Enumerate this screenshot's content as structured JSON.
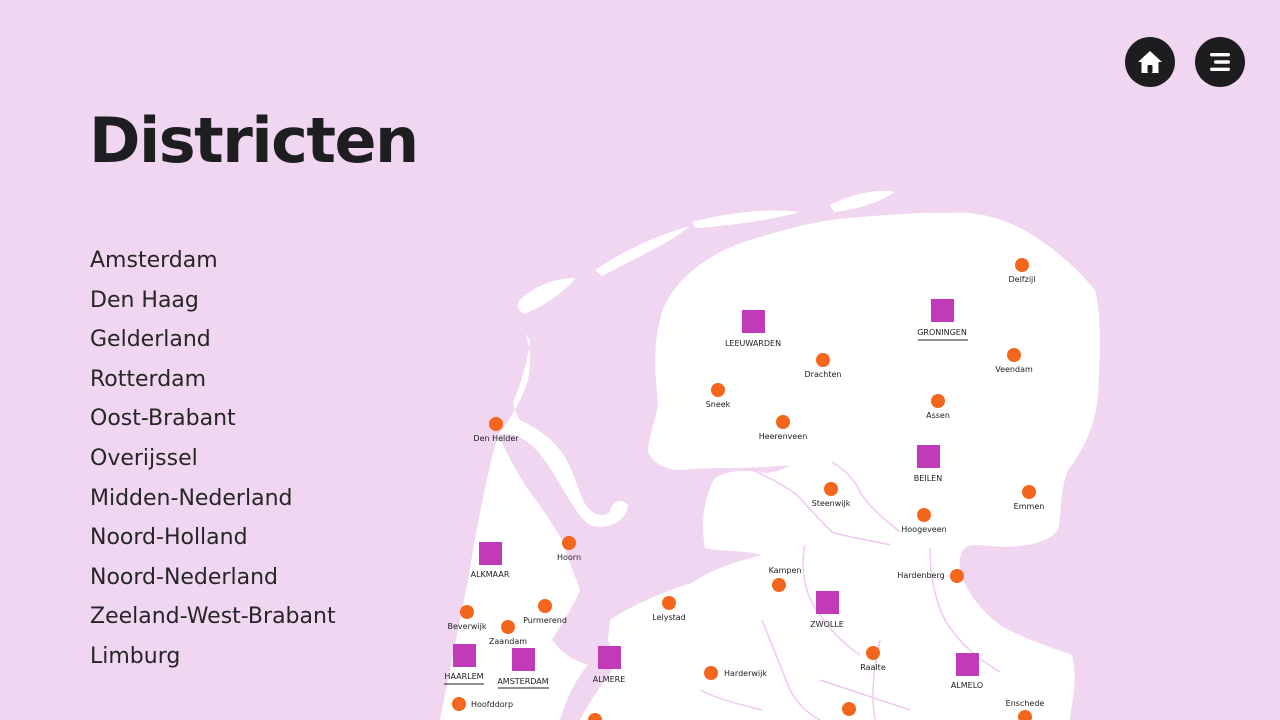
{
  "page_title": "Districten",
  "nav": {
    "home_icon": "home-icon",
    "menu_icon": "hamburger-menu-icon"
  },
  "districts": [
    "Amsterdam",
    "Den Haag",
    "Gelderland",
    "Rotterdam",
    "Oost-Brabant",
    "Overijssel",
    "Midden-Nederland",
    "Noord-Holland",
    "Noord-Nederland",
    "Zeeland-West-Brabant",
    "Limburg"
  ],
  "colors": {
    "background": "#f0d6f1",
    "land": "#ffffff",
    "district_office": "#c13ab8",
    "location": "#f4661b",
    "text": "#1e1e20"
  },
  "map": {
    "district_offices": [
      "LEEUWARDEN",
      "GRONINGEN",
      "BEILEN",
      "ALKMAAR",
      "ZWOLLE",
      "HAARLEM",
      "AMSTERDAM",
      "ALMERE",
      "ALMELO"
    ],
    "underlined_offices": [
      "GRONINGEN",
      "HAARLEM",
      "AMSTERDAM"
    ],
    "locations": [
      "Delfzijl",
      "Veendam",
      "Drachten",
      "Sneek",
      "Assen",
      "Heerenveen",
      "Den Helder",
      "Steenwijk",
      "Emmen",
      "Hoogeveen",
      "Hoorn",
      "Kampen",
      "Hardenberg",
      "Lelystad",
      "Purmerend",
      "Beverwijk",
      "Zaandam",
      "Raalte",
      "Harderwijk",
      "Enschede",
      "Hoofddorp"
    ]
  }
}
